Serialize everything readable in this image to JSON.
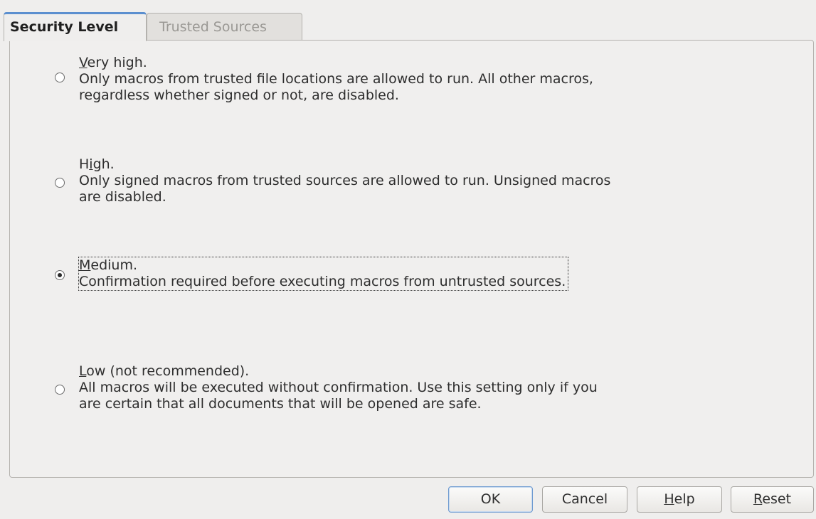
{
  "tabs": [
    {
      "label": "Security Level",
      "active": true
    },
    {
      "label": "Trusted Sources",
      "active": false
    }
  ],
  "security_options": [
    {
      "mnemonic": "V",
      "title_rest": "ery high.",
      "description_lines": [
        "Only macros from trusted file locations are allowed to run. All other macros,",
        "regardless whether signed or not, are disabled."
      ],
      "selected": false
    },
    {
      "title_pre": "H",
      "mnemonic": "i",
      "title_rest": "gh.",
      "description_lines": [
        "Only signed macros from trusted sources are allowed to run. Unsigned macros",
        "are disabled."
      ],
      "selected": false
    },
    {
      "mnemonic": "M",
      "title_rest": "edium.",
      "description_lines": [
        "Confirmation required before executing macros from untrusted sources."
      ],
      "selected": true
    },
    {
      "mnemonic": "L",
      "title_rest": "ow (not recommended).",
      "description_lines": [
        "All macros will be executed without confirmation. Use this setting only if you",
        "are certain that all documents that will be opened are safe."
      ],
      "selected": false
    }
  ],
  "buttons": {
    "ok": {
      "label": "OK",
      "default": true
    },
    "cancel": {
      "label": "Cancel"
    },
    "help": {
      "mnemonic": "H",
      "rest": "elp"
    },
    "reset": {
      "mnemonic": "R",
      "rest": "eset"
    }
  },
  "colors": {
    "accent": "#5b8fcf",
    "background": "#efeeed"
  }
}
